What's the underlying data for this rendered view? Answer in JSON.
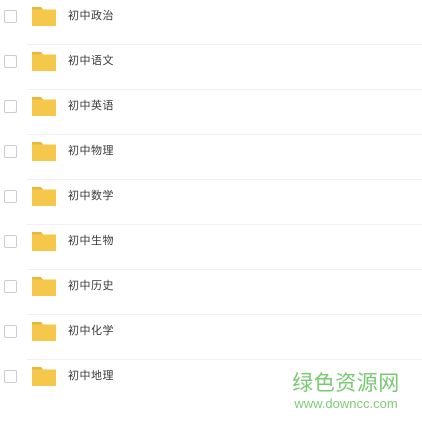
{
  "folders": [
    {
      "name": "初中政治"
    },
    {
      "name": "初中语文"
    },
    {
      "name": "初中英语"
    },
    {
      "name": "初中物理"
    },
    {
      "name": "初中数学"
    },
    {
      "name": "初中生物"
    },
    {
      "name": "初中历史"
    },
    {
      "name": "初中化学"
    },
    {
      "name": "初中地理"
    }
  ],
  "watermark": {
    "title": "绿色资源网",
    "url": "www.downcc.com"
  },
  "colors": {
    "folder": "#f5c84c",
    "folder_tab": "#e9b83a",
    "watermark": "#79c872"
  },
  "icons": {
    "folder": "folder-icon",
    "checkbox": "checkbox"
  }
}
